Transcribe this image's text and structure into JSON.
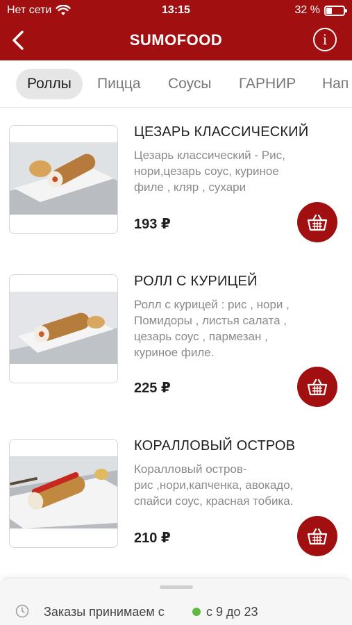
{
  "status_bar": {
    "carrier": "Нет сети",
    "time": "13:15",
    "battery": "32 %",
    "battery_level": 0.32
  },
  "header": {
    "title": "SUMOFOOD",
    "back_icon": "chevron-left-icon",
    "info_icon": "info-icon"
  },
  "tabs": [
    {
      "label": "Роллы",
      "active": true
    },
    {
      "label": "Пицца",
      "active": false
    },
    {
      "label": "Соусы",
      "active": false
    },
    {
      "label": "ГАРНИР",
      "active": false
    },
    {
      "label": "Нап",
      "active": false
    }
  ],
  "products": [
    {
      "name": "ЦЕЗАРЬ КЛАССИЧЕСКИЙ",
      "desc_lines": [
        "Цезарь классический - Рис,",
        "нори,цезарь соус, куриное",
        "филе , кляр , сухари"
      ],
      "price": "193 ₽"
    },
    {
      "name": "РОЛЛ С КУРИЦЕЙ",
      "desc_lines": [
        "Ролл с курицей : рис , нори ,",
        "Помидоры , листья салата ,",
        "цезарь соус , пармезан ,",
        "куриное филе."
      ],
      "price": "225 ₽"
    },
    {
      "name": "КОРАЛЛОВЫЙ ОСТРОВ",
      "desc_lines": [
        "Коралловый остров-",
        "рис ,нори,капченка, авокадо,",
        "спайси соус, красная тобика."
      ],
      "price": "210 ₽"
    }
  ],
  "footer": {
    "label": "Заказы принимаем с",
    "hours": "с 9 до 23",
    "status_color": "#5dbb3f"
  },
  "colors": {
    "brand": "#a10f10"
  }
}
